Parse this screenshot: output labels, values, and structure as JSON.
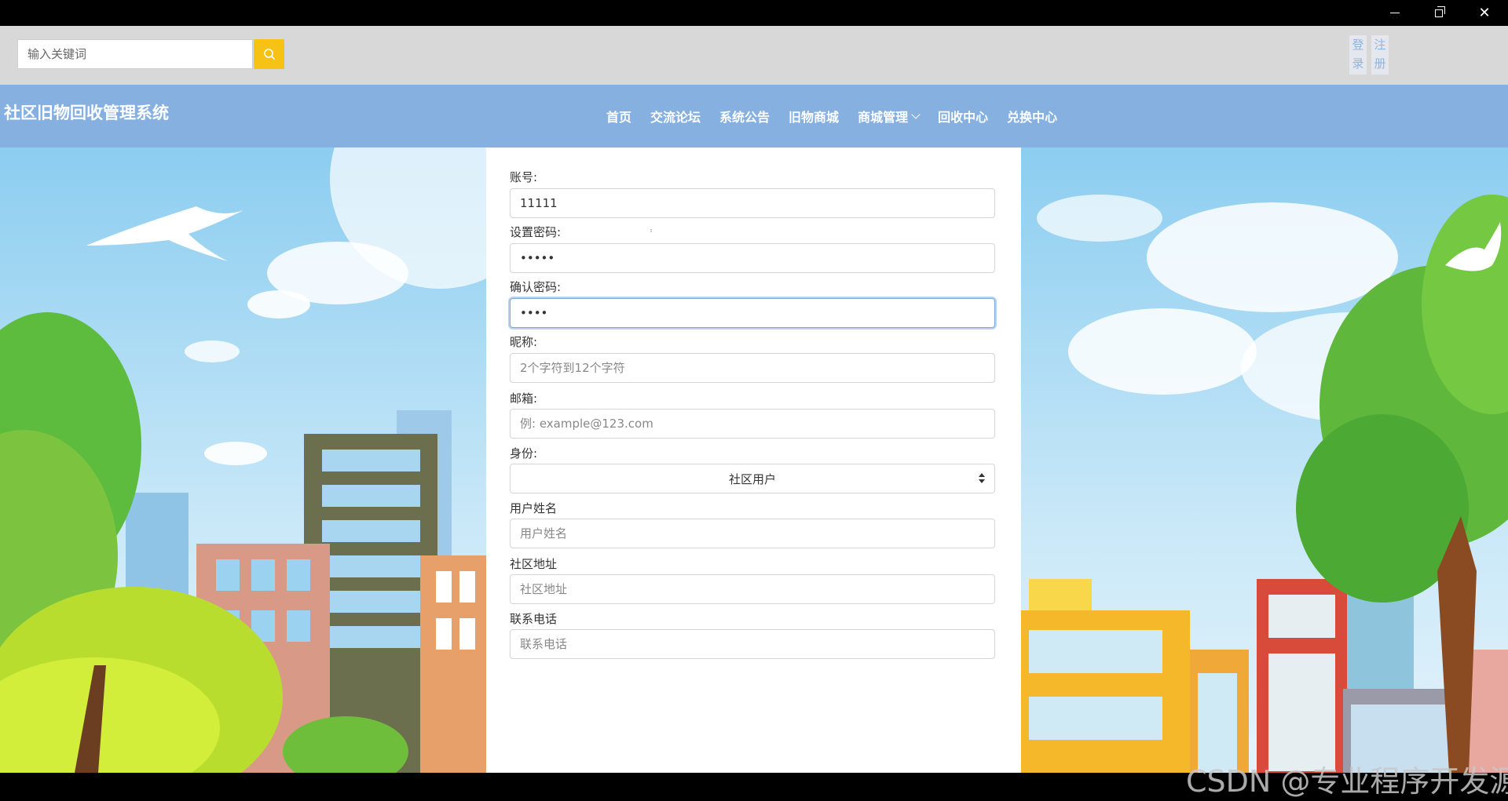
{
  "header": {
    "search_placeholder": "输入关键词",
    "login_label": "登录",
    "register_label": "注册"
  },
  "navbar": {
    "logo": "社区旧物回收管理系统",
    "items": [
      {
        "label": "首页"
      },
      {
        "label": "交流论坛"
      },
      {
        "label": "系统公告"
      },
      {
        "label": "旧物商城"
      },
      {
        "label": "商城管理"
      },
      {
        "label": "回收中心"
      },
      {
        "label": "兑换中心"
      }
    ]
  },
  "form": {
    "account_label": "账号:",
    "account_value": "11111",
    "password_label": "设置密码:",
    "password_value": "•••••",
    "confirm_label": "确认密码:",
    "confirm_value": "••••",
    "nickname_label": "昵称:",
    "nickname_placeholder": "2个字符到12个字符",
    "email_label": "邮箱:",
    "email_placeholder": "例: example@123.com",
    "identity_label": "身份:",
    "identity_value": "社区用户",
    "username_label": "用户姓名",
    "username_placeholder": "用户姓名",
    "address_label": "社区地址",
    "address_placeholder": "社区地址",
    "phone_label": "联系电话",
    "phone_placeholder": "联系电话"
  },
  "watermark": "CSDN @专业程序开发源",
  "colors": {
    "navbar": "#86b0e0",
    "topbar": "#d8d8d8",
    "search_button": "#f6c215",
    "auth_text": "#8fb3e0"
  },
  "icons": {
    "search_button": "search-icon",
    "window_minimize": "minimize-icon",
    "window_restore": "restore-icon",
    "window_close": "close-icon",
    "dropdown": "chevron-down-icon"
  }
}
